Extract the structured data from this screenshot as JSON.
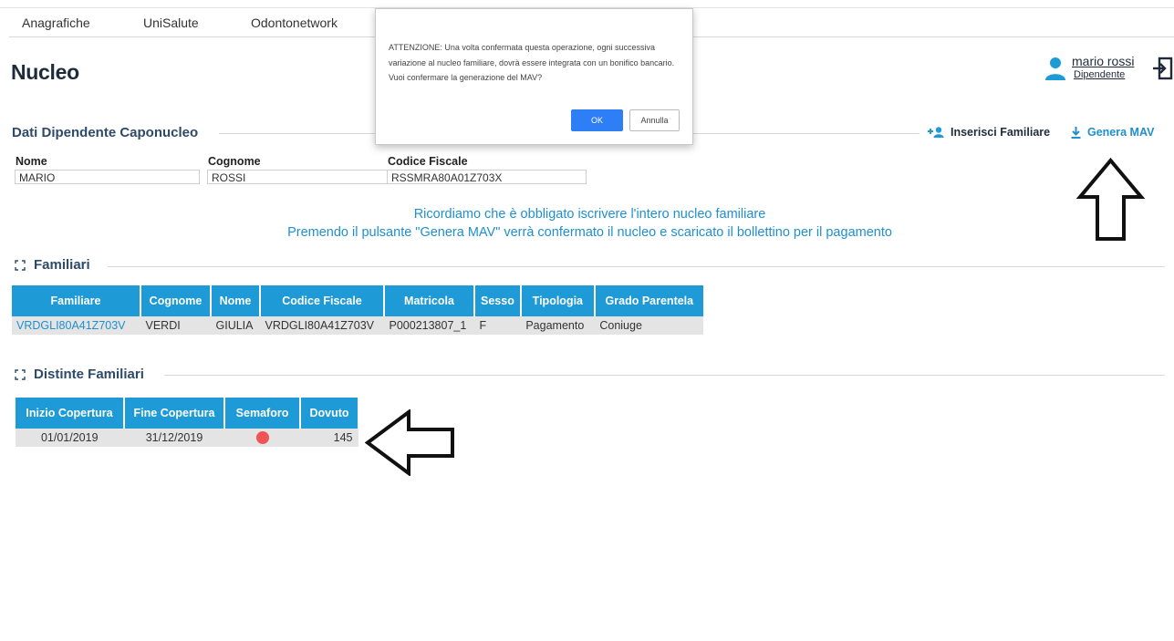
{
  "nav": {
    "items": [
      "Anagrafiche",
      "UniSalute",
      "Odontonetwork"
    ]
  },
  "page": {
    "title": "Nucleo"
  },
  "user": {
    "name": "mario rossi",
    "role": "Dipendente"
  },
  "dialog": {
    "message": "ATTENZIONE: Una volta confermata questa operazione, ogni successiva variazione al nucleo familiare, dovrà essere integrata con un bonifico bancario. Vuoi confermare la generazione del MAV?",
    "ok_label": "OK",
    "cancel_label": "Annulla"
  },
  "caponucleo": {
    "title": "Dati Dipendente Caponucleo",
    "insert_label": "Inserisci Familiare",
    "mav_label": "Genera MAV",
    "fields": {
      "nome_label": "Nome",
      "nome_value": "MARIO",
      "cognome_label": "Cognome",
      "cognome_value": "ROSSI",
      "cf_label": "Codice Fiscale",
      "cf_value": "RSSMRA80A01Z703X"
    }
  },
  "notice": {
    "line1": "Ricordiamo che è obbligato iscrivere l'intero nucleo familiare",
    "line2": "Premendo il pulsante \"Genera MAV\" verrà confermato il nucleo e scaricato il bollettino per il pagamento"
  },
  "familiari": {
    "title": "Familiari",
    "headers": [
      "Familiare",
      "Cognome",
      "Nome",
      "Codice Fiscale",
      "Matricola",
      "Sesso",
      "Tipologia",
      "Grado Parentela"
    ],
    "rows": [
      [
        "VRDGLI80A41Z703V",
        "VERDI",
        "GIULIA",
        "VRDGLI80A41Z703V",
        "P000213807_1",
        "F",
        "Pagamento",
        "Coniuge"
      ]
    ]
  },
  "distinte": {
    "title": "Distinte Familiari",
    "headers": [
      "Inizio Copertura",
      "Fine Copertura",
      "Semaforo",
      "Dovuto"
    ],
    "rows": [
      {
        "inizio": "01/01/2019",
        "fine": "31/12/2019",
        "semaforo_color": "#f05454",
        "dovuto": "145"
      }
    ]
  },
  "colors": {
    "accent": "#1e9ad6",
    "link": "#1f8fd0",
    "ok_button": "#2e7ef5",
    "title": "#2d4a6a"
  },
  "icons": {
    "user": "user-icon",
    "logout": "logout-icon",
    "add_user": "add-user-icon",
    "download": "download-icon",
    "expand": "expand-icon",
    "arrow_up": "arrow-up-annotation",
    "arrow_left": "arrow-left-annotation"
  }
}
